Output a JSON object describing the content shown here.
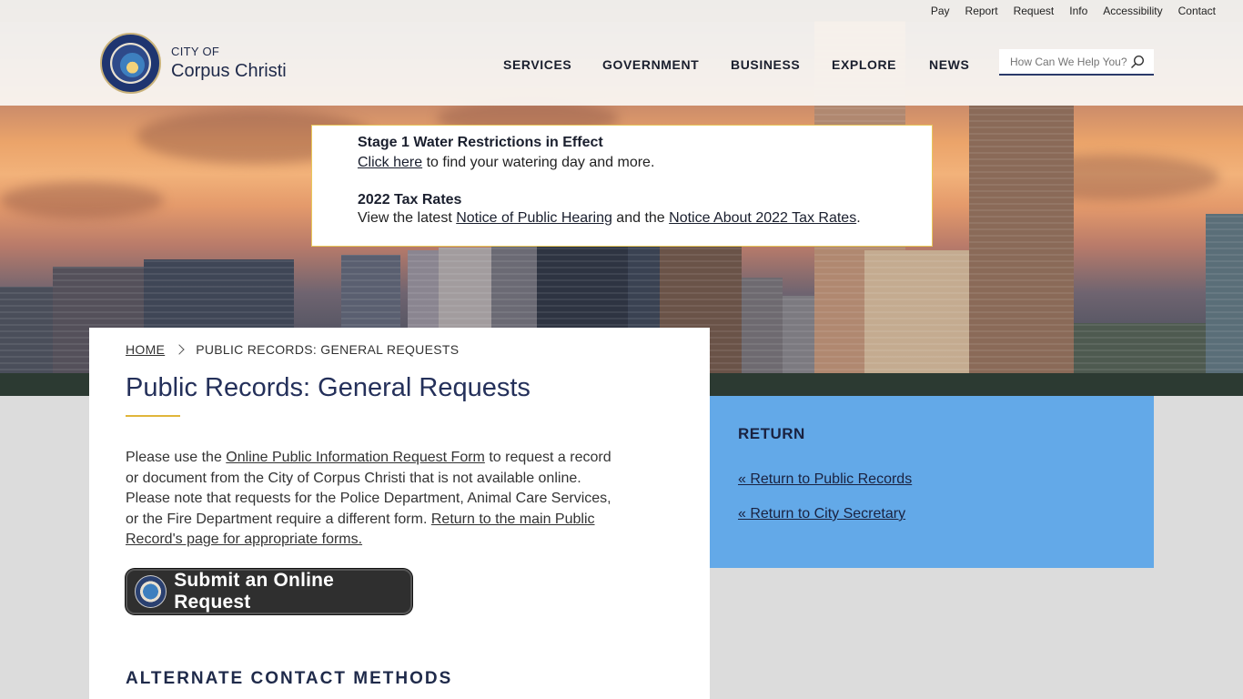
{
  "utility_nav": [
    "Pay",
    "Report",
    "Request",
    "Info",
    "Accessibility",
    "Contact"
  ],
  "brand": {
    "small": "CITY OF",
    "name": "Corpus Christi"
  },
  "main_nav": [
    "SERVICES",
    "GOVERNMENT",
    "BUSINESS",
    "EXPLORE",
    "NEWS"
  ],
  "search": {
    "placeholder": "How Can We Help You?"
  },
  "alert": {
    "item1_title": "Stage 1 Water Restrictions in Effect",
    "item1_link": "Click here",
    "item1_text": " to find your watering day and more.",
    "item2_title": "2022 Tax Rates",
    "item2_prefix": "View the latest ",
    "item2_link1": "Notice of Public Hearing",
    "item2_mid": " and the ",
    "item2_link2": "Notice About 2022 Tax Rates",
    "item2_suffix": "."
  },
  "breadcrumb": {
    "home": "HOME",
    "current": "PUBLIC RECORDS: GENERAL REQUESTS"
  },
  "page_title": "Public Records: General Requests",
  "body": {
    "p_prefix": "Please use the ",
    "p_link1": "Online Public Information Request Form",
    "p_mid": " to request a record or document from the City of Corpus Christi that is not available online. Please note that requests for the Police Department, Animal Care Services, or the Fire Department require a different form. ",
    "p_link2": "Return to the main Public Record's page for appropriate forms."
  },
  "submit_button": {
    "label": "Submit an Online Request"
  },
  "alternate_heading": "ALTERNATE CONTACT METHODS",
  "sidebar": {
    "title": "RETURN",
    "links": [
      "« Return to Public Records",
      "« Return to City Secretary"
    ]
  },
  "colors": {
    "accent_gold": "#e0b53a",
    "sidebar_blue": "#63a9e8",
    "title_navy": "#24305a"
  }
}
